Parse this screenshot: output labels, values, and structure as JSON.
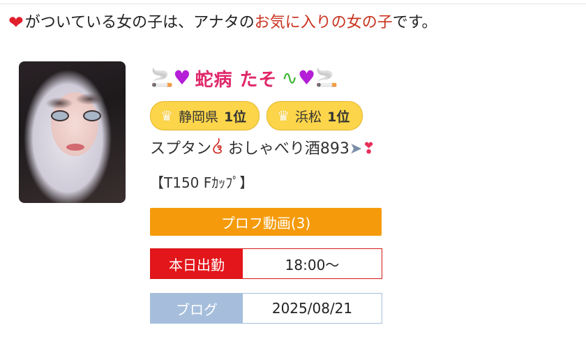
{
  "notice": {
    "text_before": "がついている女の子は、アナタの",
    "highlight": "お気に入りの女の子",
    "text_after": "です。"
  },
  "icons": {
    "heart": "heart-icon",
    "smoke": "smoking-icon",
    "purple_heart": "purple-heart-icon",
    "snake": "snake-icon",
    "crown": "crown-icon"
  },
  "colors": {
    "heart": "#e0202a",
    "highlight": "#c8321e",
    "name": "#e0286a",
    "rank_badge": "#fcd54a",
    "video_button": "#f59b0b",
    "work_label": "#e2161b",
    "blog_label": "#a6bedc"
  },
  "cast": {
    "name": "蛇病 たそ",
    "ranks": [
      {
        "area": "静岡県",
        "rank": "1位"
      },
      {
        "area": "浜松",
        "rank": "1位"
      }
    ],
    "tagline_part1": "スプタン",
    "tagline_part2": "おしゃべり酒893",
    "spec": "【T150 Fｶｯﾌﾟ】",
    "video_button": "プロフ動画(3)",
    "work": {
      "label": "本日出勤",
      "value": "18:00～"
    },
    "blog": {
      "label": "ブログ",
      "value": "2025/08/21"
    }
  }
}
